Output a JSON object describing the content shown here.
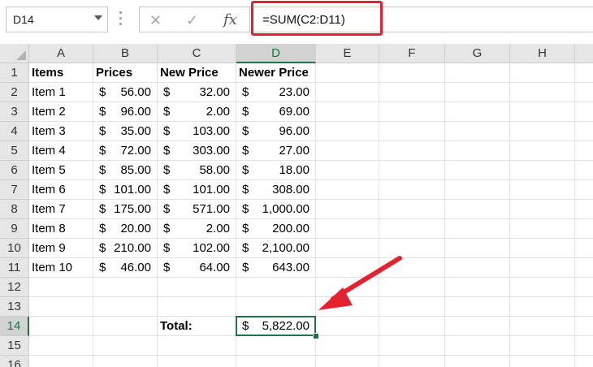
{
  "name_box": {
    "value": "D14"
  },
  "formula_bar": {
    "formula": "=SUM(C2:D11)",
    "fx_label": "fx"
  },
  "icons": {
    "cancel": "✕",
    "enter": "✓"
  },
  "colors": {
    "accent": "#217346",
    "highlight": "#e3212f"
  },
  "selected": {
    "column": "D",
    "row": "14"
  },
  "columns": [
    "A",
    "B",
    "C",
    "D",
    "E",
    "F",
    "G",
    "H"
  ],
  "rows": [
    "1",
    "2",
    "3",
    "4",
    "5",
    "6",
    "7",
    "8",
    "9",
    "10",
    "11",
    "12",
    "13",
    "14",
    "15",
    "16"
  ],
  "headers": {
    "items": "Items",
    "prices": "Prices",
    "new_price": "New Price",
    "newer_price": "Newer Price"
  },
  "data_rows": [
    {
      "item": "Item 1",
      "b": "56.00",
      "c": "32.00",
      "d": "23.00"
    },
    {
      "item": "Item 2",
      "b": "96.00",
      "c": "2.00",
      "d": "69.00"
    },
    {
      "item": "Item 3",
      "b": "35.00",
      "c": "103.00",
      "d": "96.00"
    },
    {
      "item": "Item 4",
      "b": "72.00",
      "c": "303.00",
      "d": "27.00"
    },
    {
      "item": "Item 5",
      "b": "85.00",
      "c": "58.00",
      "d": "18.00"
    },
    {
      "item": "Item 6",
      "b": "101.00",
      "c": "101.00",
      "d": "308.00"
    },
    {
      "item": "Item 7",
      "b": "175.00",
      "c": "571.00",
      "d": "1,000.00"
    },
    {
      "item": "Item 8",
      "b": "20.00",
      "c": "2.00",
      "d": "200.00"
    },
    {
      "item": "Item 9",
      "b": "210.00",
      "c": "102.00",
      "d": "2,100.00"
    },
    {
      "item": "Item 10",
      "b": "46.00",
      "c": "64.00",
      "d": "643.00"
    }
  ],
  "currency_symbol": "$",
  "total": {
    "label": "Total:",
    "value": "5,822.00"
  }
}
